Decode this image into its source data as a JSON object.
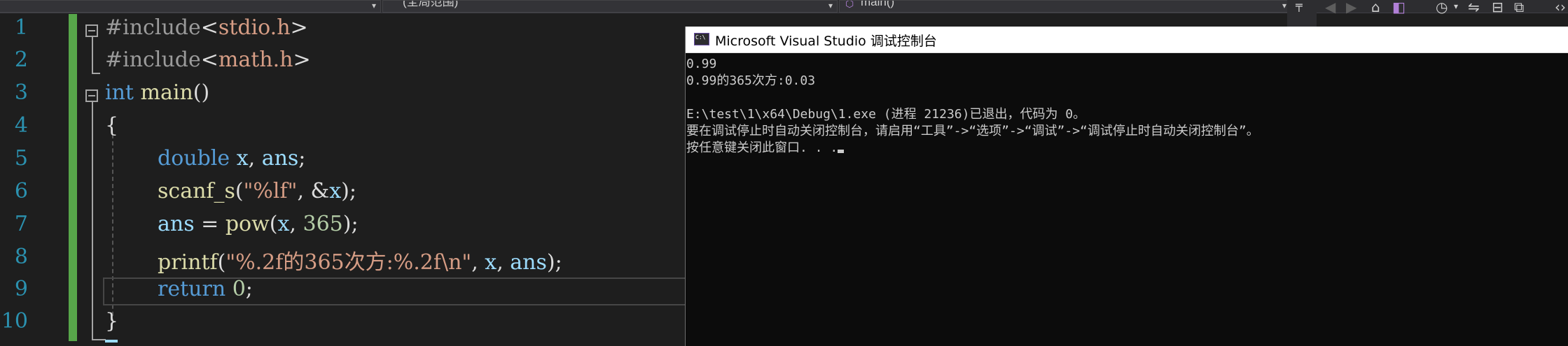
{
  "nav_bar": {
    "scope_dropdown": "(全局范围)",
    "member_dropdown": "main()"
  },
  "editor": {
    "line_numbers": [
      "1",
      "2",
      "3",
      "4",
      "5",
      "6",
      "7",
      "8",
      "9",
      "10"
    ],
    "lines": {
      "l1": {
        "directive": "#include",
        "lt": "<",
        "header": "stdio.h",
        "gt": ">"
      },
      "l2": {
        "directive": "#include",
        "lt": "<",
        "header": "math.h",
        "gt": ">"
      },
      "l3": {
        "kw": "int",
        "name": "main",
        "paren": "()"
      },
      "l4": {
        "brace": "{"
      },
      "l5": {
        "kw": "double",
        "v1": "x",
        "sep": ", ",
        "v2": "ans",
        "end": ";"
      },
      "l6": {
        "fn": "scanf_s",
        "open": "(",
        "fmt": "\"%lf\"",
        "sep": ", &",
        "v": "x",
        "close": ");"
      },
      "l7": {
        "v1": "ans",
        "eq": " = ",
        "fn": "pow",
        "open": "(",
        "v2": "x",
        "sep": ", ",
        "num": "365",
        "close": ");"
      },
      "l8": {
        "fn": "printf",
        "open": "(",
        "fmt": "\"%.2f的365次方:%.2f\\n\"",
        "sep1": ", ",
        "v1": "x",
        "sep2": ", ",
        "v2": "ans",
        "close": ");"
      },
      "l9": {
        "kw": "return",
        "num": "0",
        "end": ";"
      },
      "l10": {
        "brace": "}"
      }
    }
  },
  "console": {
    "title": "Microsoft Visual Studio 调试控制台",
    "lines": [
      "0.99",
      "0.99的365次方:0.03",
      "",
      "E:\\test\\1\\x64\\Debug\\1.exe (进程 21236)已退出，代码为 0。",
      "要在调试停止时自动关闭控制台，请启用“工具”->“选项”->“调试”->“调试停止时自动关闭控制台”。",
      "按任意键关闭此窗口. . ."
    ]
  }
}
